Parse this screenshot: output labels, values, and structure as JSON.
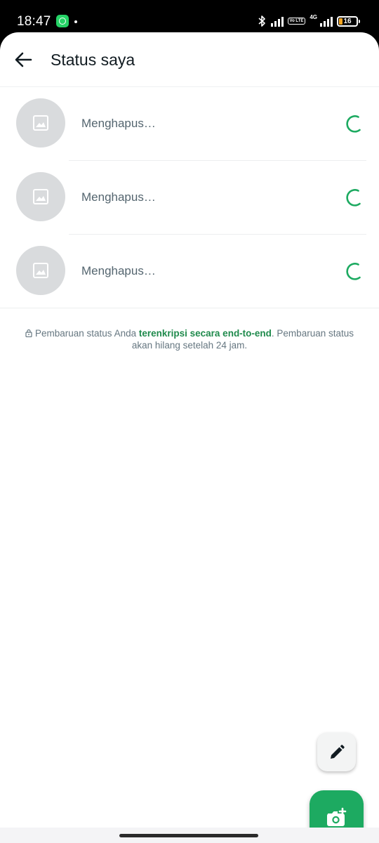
{
  "statusbar": {
    "time": "18:47",
    "battery_level": "16",
    "network_type": "4G",
    "volte_label": "Vo LTE"
  },
  "appbar": {
    "title": "Status saya",
    "back_icon": "arrow-left-icon"
  },
  "status_items": [
    {
      "label": "Menghapus…",
      "thumbnail_icon": "image-icon",
      "progress_icon": "loading-spinner-icon"
    },
    {
      "label": "Menghapus…",
      "thumbnail_icon": "image-icon",
      "progress_icon": "loading-spinner-icon"
    },
    {
      "label": "Menghapus…",
      "thumbnail_icon": "image-icon",
      "progress_icon": "loading-spinner-icon"
    }
  ],
  "footer_note": {
    "prefix": "Pembaruan status Anda ",
    "link": "terenkripsi secara end-to-end",
    "suffix": ". Pembaruan status akan hilang setelah 24 jam."
  },
  "fabs": {
    "edit_icon": "pencil-icon",
    "camera_icon": "camera-plus-icon"
  },
  "colors": {
    "accent_green": "#1daa61",
    "link_green": "#1f8a4c",
    "battery_orange": "#F6A623"
  }
}
